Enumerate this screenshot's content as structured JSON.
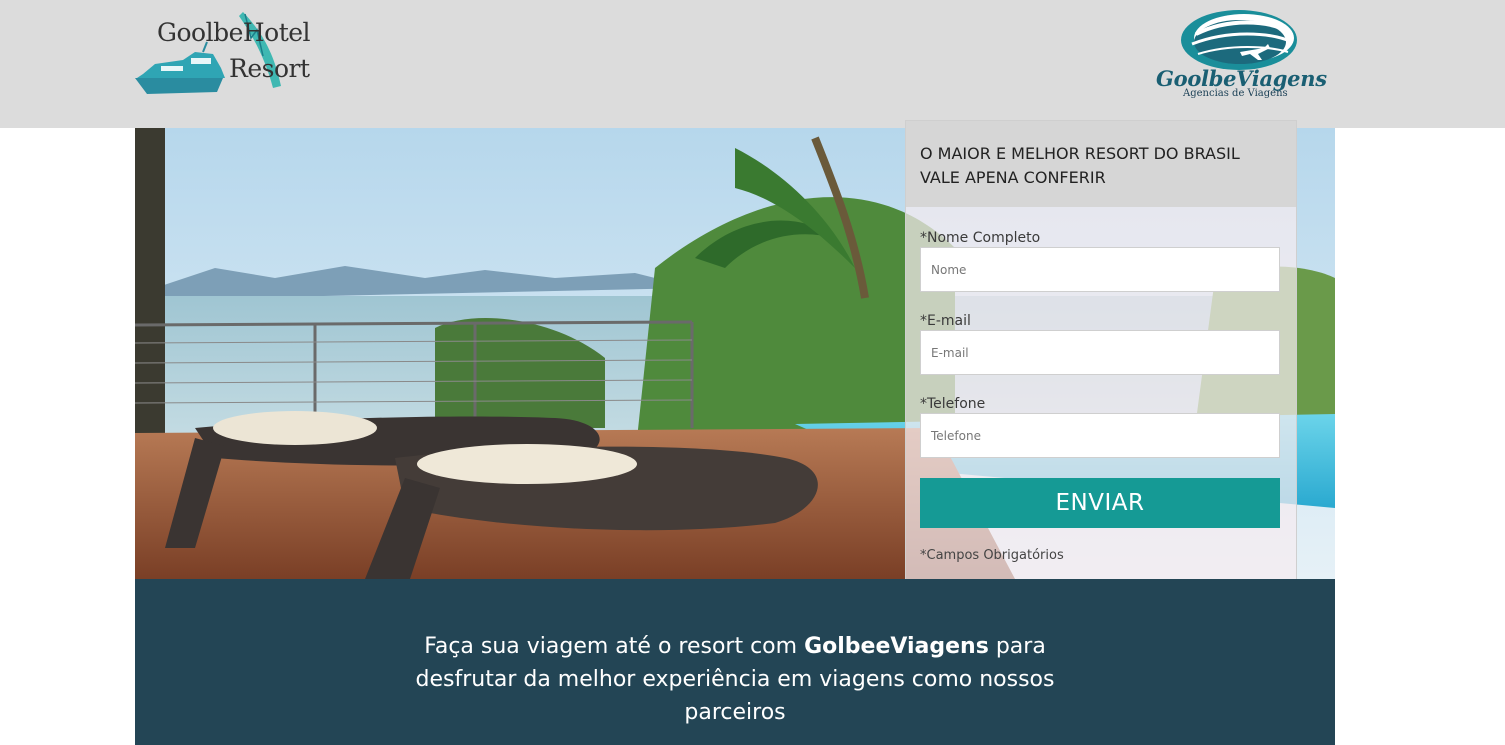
{
  "header": {
    "left_logo": {
      "line1": "GoolbeHotel",
      "line2": "Resort",
      "icon": "boat-icon"
    },
    "right_logo": {
      "name": "GoolbeViagens",
      "subtitle": "Agencias de Viagens",
      "icon": "globe-airplane-icon"
    },
    "bg_color": "#dcdcdc"
  },
  "hero": {
    "image": "resort-pool-deck-photo"
  },
  "form": {
    "heading_line1": "O MAIOR E MELHOR RESORT DO BRASIL",
    "heading_line2": "VALE APENA CONFERIR",
    "fields": [
      {
        "label": "*Nome Completo",
        "placeholder": "Nome"
      },
      {
        "label": "*E-mail",
        "placeholder": "E-mail"
      },
      {
        "label": "*Telefone",
        "placeholder": "Telefone"
      }
    ],
    "submit_label": "ENVIAR",
    "required_note": "*Campos Obrigatórios",
    "accent_color": "#159a95"
  },
  "footer": {
    "text_before": "Faça sua viagem até o resort com ",
    "brand": "GolbeeViagens",
    "text_after_1": " para",
    "line2": "desfrutar da melhor experiência em viagens como nossos",
    "line3": "parceiros",
    "bg_color": "#234555"
  }
}
